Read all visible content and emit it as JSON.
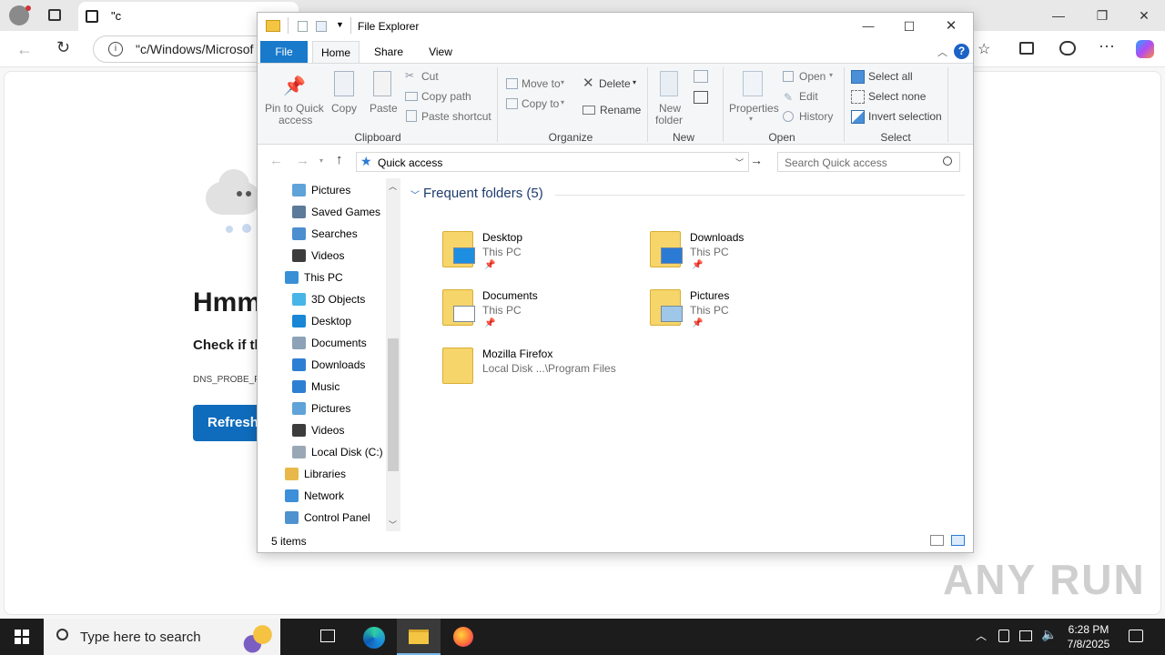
{
  "browser": {
    "tab_title": "\"c",
    "url": "\"c/Windows/Microsof",
    "error_heading": "Hmm",
    "error_sub": "Check if th",
    "error_code": "DNS_PROBE_FIN",
    "refresh_label": "Refresh"
  },
  "explorer": {
    "title": "File Explorer",
    "tabs": [
      "File",
      "Home",
      "Share",
      "View"
    ],
    "ribbon": {
      "clipboard": {
        "pin": "Pin to Quick",
        "pin2": "access",
        "copy": "Copy",
        "paste": "Paste",
        "cut": "Cut",
        "copy_path": "Copy path",
        "paste_shortcut": "Paste shortcut",
        "group": "Clipboard"
      },
      "organize": {
        "move_to": "Move to",
        "copy_to": "Copy to",
        "delete": "Delete",
        "rename": "Rename",
        "group": "Organize"
      },
      "new": {
        "new_folder": "New",
        "new_folder2": "folder",
        "group": "New"
      },
      "open": {
        "properties": "Properties",
        "open": "Open",
        "edit": "Edit",
        "history": "History",
        "group": "Open"
      },
      "select": {
        "select_all": "Select all",
        "select_none": "Select none",
        "invert": "Invert selection",
        "group": "Select"
      }
    },
    "path": "Quick access",
    "search_placeholder": "Search Quick access",
    "nav_items": [
      {
        "label": "Pictures",
        "icon": "pictures-icon"
      },
      {
        "label": "Saved Games",
        "icon": "saved-games-icon"
      },
      {
        "label": "Searches",
        "icon": "searches-icon"
      },
      {
        "label": "Videos",
        "icon": "videos-icon"
      },
      {
        "label": "This PC",
        "icon": "this-pc-icon"
      },
      {
        "label": "3D Objects",
        "icon": "3d-objects-icon"
      },
      {
        "label": "Desktop",
        "icon": "desktop-icon"
      },
      {
        "label": "Documents",
        "icon": "documents-icon"
      },
      {
        "label": "Downloads",
        "icon": "downloads-icon"
      },
      {
        "label": "Music",
        "icon": "music-icon"
      },
      {
        "label": "Pictures",
        "icon": "pictures-icon"
      },
      {
        "label": "Videos",
        "icon": "videos-icon"
      },
      {
        "label": "Local Disk (C:)",
        "icon": "local-disk-icon"
      },
      {
        "label": "Libraries",
        "icon": "libraries-icon"
      },
      {
        "label": "Network",
        "icon": "network-icon"
      },
      {
        "label": "Control Panel",
        "icon": "control-panel-icon"
      }
    ],
    "section_title": "Frequent folders (5)",
    "folders": [
      {
        "name": "Desktop",
        "sub": "This PC",
        "pinned": true
      },
      {
        "name": "Downloads",
        "sub": "This PC",
        "pinned": true
      },
      {
        "name": "Documents",
        "sub": "This PC",
        "pinned": true
      },
      {
        "name": "Pictures",
        "sub": "This PC",
        "pinned": true
      },
      {
        "name": "Mozilla Firefox",
        "sub": "Local Disk ...\\Program Files",
        "pinned": false
      }
    ],
    "status": "5 items"
  },
  "taskbar": {
    "search_placeholder": "Type here to search",
    "time": "6:28 PM",
    "date": "7/8/2025"
  },
  "watermark": "ANY RUN"
}
